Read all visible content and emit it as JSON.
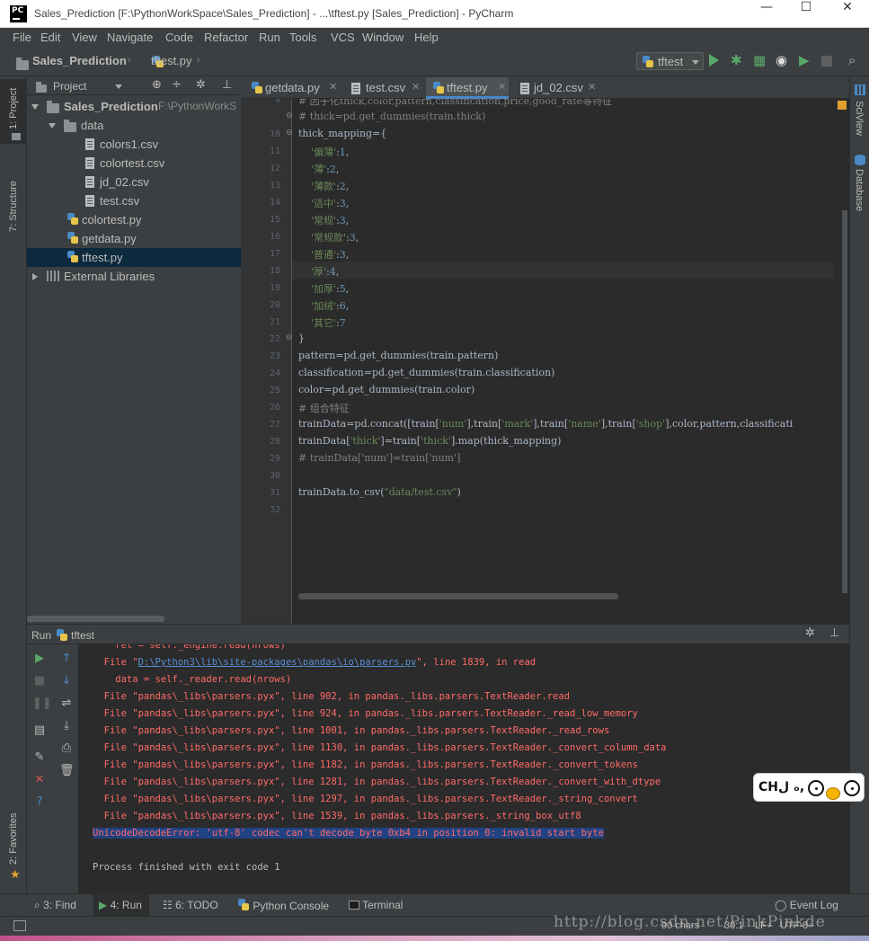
{
  "window": {
    "title": "Sales_Prediction [F:\\PythonWorkSpace\\Sales_Prediction] - ...\\tftest.py [Sales_Prediction] - PyCharm",
    "app_logo": "PC",
    "minimize": "—",
    "maximize": "☐",
    "close": "✕"
  },
  "menu": [
    "File",
    "Edit",
    "View",
    "Navigate",
    "Code",
    "Refactor",
    "Run",
    "Tools",
    "VCS",
    "Window",
    "Help"
  ],
  "navbar": {
    "project": "Sales_Prediction",
    "file": "tftest.py",
    "run_config": "tftest",
    "run_icon": "play-icon",
    "debug_icon": "bug-icon"
  },
  "left_tabs": [
    "1: Project",
    "7: Structure",
    "2: Favorites"
  ],
  "right_tabs": [
    "SciView",
    "Database"
  ],
  "project_panel": {
    "title": "Project",
    "tree": [
      {
        "label": "Sales_Prediction",
        "path": "F:\\PythonWorkS",
        "type": "folder",
        "indent": 0
      },
      {
        "label": "data",
        "type": "folder",
        "indent": 1
      },
      {
        "label": "colors1.csv",
        "type": "csv",
        "indent": 2
      },
      {
        "label": "colortest.csv",
        "type": "csv",
        "indent": 2
      },
      {
        "label": "jd_02.csv",
        "type": "csv",
        "indent": 2
      },
      {
        "label": "test.csv",
        "type": "csv",
        "indent": 2
      },
      {
        "label": "colortest.py",
        "type": "py",
        "indent": 1
      },
      {
        "label": "getdata.py",
        "type": "py",
        "indent": 1
      },
      {
        "label": "tftest.py",
        "type": "py",
        "indent": 1,
        "selected": true
      },
      {
        "label": "External Libraries",
        "type": "lib",
        "indent": 0
      }
    ]
  },
  "editor_tabs": [
    {
      "label": "getdata.py",
      "type": "py"
    },
    {
      "label": "test.csv",
      "type": "csv"
    },
    {
      "label": "tftest.py",
      "type": "py",
      "active": true
    },
    {
      "label": "jd_02.csv",
      "type": "csv"
    }
  ],
  "code_lines": [
    {
      "n": "9",
      "html": "<span class=\"c\"># 因子化thick,color,pattern,classification,price,good_rate等特征</span>"
    },
    {
      "n": "",
      "html": "<span class=\"c\"># thick=pd.get_dummies(train.thick)</span>"
    },
    {
      "n": "10",
      "html": "thick_mapping={"
    },
    {
      "n": "11",
      "html": "    <span class=\"s\">'偏薄'</span>:<span class=\"n\">1</span>,"
    },
    {
      "n": "12",
      "html": "    <span class=\"s\">'薄'</span>:<span class=\"n\">2</span>,"
    },
    {
      "n": "13",
      "html": "    <span class=\"s\">'薄款'</span>:<span class=\"n\">2</span>,"
    },
    {
      "n": "14",
      "html": "    <span class=\"s\">'适中'</span>:<span class=\"n\">3</span>,"
    },
    {
      "n": "15",
      "html": "    <span class=\"s\">'常规'</span>:<span class=\"n\">3</span>,"
    },
    {
      "n": "16",
      "html": "    <span class=\"s\">'常规款'</span>:<span class=\"n\">3</span>,"
    },
    {
      "n": "17",
      "html": "    <span class=\"s\">'普通'</span>:<span class=\"n\">3</span>,"
    },
    {
      "n": "18",
      "html": "    <span class=\"s\">'厚'</span>:<span class=\"n\">4</span>,"
    },
    {
      "n": "19",
      "html": "    <span class=\"s\">'加厚'</span>:<span class=\"n\">5</span>,"
    },
    {
      "n": "20",
      "html": "    <span class=\"s\">'加绒'</span>:<span class=\"n\">6</span>,"
    },
    {
      "n": "21",
      "html": "    <span class=\"s\">'其它'</span>:<span class=\"n\">7</span>"
    },
    {
      "n": "22",
      "html": "}"
    },
    {
      "n": "23",
      "html": "pattern=pd.get_dummies(train.pattern)"
    },
    {
      "n": "24",
      "html": "classification=pd.get_dummies(train.classification)"
    },
    {
      "n": "25",
      "html": "color=pd.get_dummies(train.color)"
    },
    {
      "n": "26",
      "html": "<span class=\"c\"># 组合特征</span>"
    },
    {
      "n": "27",
      "html": "trainData=pd.concat([train[<span class=\"s\">'num'</span>],train[<span class=\"s\">'mark'</span>],train[<span class=\"s\">'name'</span>],train[<span class=\"s\">'shop'</span>],color,pattern,classificati"
    },
    {
      "n": "28",
      "html": "trainData[<span class=\"s\">'thick'</span>]=train[<span class=\"s\">'thick'</span>].map(thick_mapping)"
    },
    {
      "n": "29",
      "html": "<span class=\"c\"># trainData['num']=train['num']</span>"
    },
    {
      "n": "30",
      "html": ""
    },
    {
      "n": "31",
      "html": "trainData.to_csv(<span class=\"s\">\"data/test.csv\"</span>)"
    },
    {
      "n": "32",
      "html": ""
    }
  ],
  "run_panel": {
    "label": "Run",
    "config": "tftest",
    "lines": [
      {
        "t": "    ret = self._engine.read(nrows)",
        "k": "err"
      },
      {
        "t": "  File \"<a>D:\\Python3\\lib\\site-packages\\pandas\\io\\parsers.py</a>\", line 1839, in read",
        "k": "err"
      },
      {
        "t": "    data = self._reader.read(nrows)",
        "k": "err"
      },
      {
        "t": "  File \"pandas\\_libs\\parsers.pyx\", line 902, in pandas._libs.parsers.TextReader.read",
        "k": "err"
      },
      {
        "t": "  File \"pandas\\_libs\\parsers.pyx\", line 924, in pandas._libs.parsers.TextReader._read_low_memory",
        "k": "err"
      },
      {
        "t": "  File \"pandas\\_libs\\parsers.pyx\", line 1001, in pandas._libs.parsers.TextReader._read_rows",
        "k": "err"
      },
      {
        "t": "  File \"pandas\\_libs\\parsers.pyx\", line 1130, in pandas._libs.parsers.TextReader._convert_column_data",
        "k": "err"
      },
      {
        "t": "  File \"pandas\\_libs\\parsers.pyx\", line 1182, in pandas._libs.parsers.TextReader._convert_tokens",
        "k": "err"
      },
      {
        "t": "  File \"pandas\\_libs\\parsers.pyx\", line 1281, in pandas._libs.parsers.TextReader._convert_with_dtype",
        "k": "err"
      },
      {
        "t": "  File \"pandas\\_libs\\parsers.pyx\", line 1297, in pandas._libs.parsers.TextReader._string_convert",
        "k": "err"
      },
      {
        "t": "  File \"pandas\\_libs\\parsers.pyx\", line 1539, in pandas._libs.parsers._string_box_utf8",
        "k": "err"
      },
      {
        "t": "UnicodeDecodeError: 'utf-8' codec can't decode byte 0xb4 in position 0: invalid start byte",
        "k": "hl"
      },
      {
        "t": "",
        "k": "ok"
      },
      {
        "t": "Process finished with exit code 1",
        "k": "ok"
      }
    ]
  },
  "bottom_tabs": [
    {
      "label": "3: Find",
      "icon": "search-icon"
    },
    {
      "label": "4: Run",
      "icon": "play-icon",
      "active": true
    },
    {
      "label": "6: TODO",
      "icon": "todo-icon"
    },
    {
      "label": "Python Console",
      "icon": "python-icon"
    },
    {
      "label": "Terminal",
      "icon": "terminal-icon"
    }
  ],
  "event_log": "Event Log",
  "status": {
    "chars": "90 chars",
    "position": "30:1",
    "line_sep": "LF÷",
    "encoding": "UTF-8÷"
  },
  "watermark": "http://blog.csdn.net/PinkPinkde",
  "sticker_text": "CHﻝ ₒ,",
  "colors": {
    "accent": "#4a88c7",
    "error": "#ff6b68",
    "string": "#6a8759",
    "selection": "#0d293e"
  }
}
